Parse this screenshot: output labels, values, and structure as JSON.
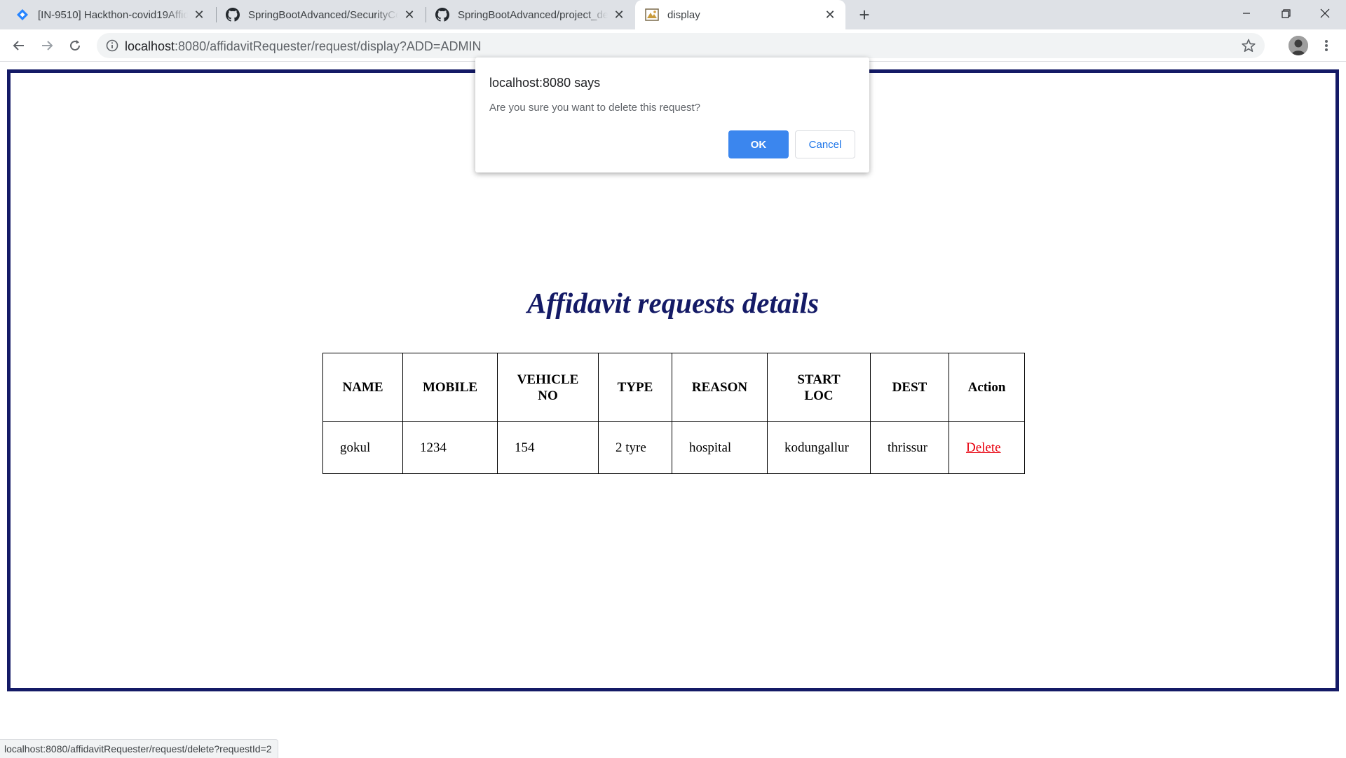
{
  "browser": {
    "tabs": [
      {
        "title": "[IN-9510] Hackthon-covid19Affidavit",
        "icon": "jira-diamond-icon",
        "active": false
      },
      {
        "title": "SpringBootAdvanced/SecurityConfig",
        "icon": "github-icon",
        "active": false
      },
      {
        "title": "SpringBootAdvanced/project_details",
        "icon": "github-icon",
        "active": false
      },
      {
        "title": "display",
        "icon": "page-favicon-icon",
        "active": true
      }
    ],
    "url_host": "localhost",
    "url_rest": ":8080/affidavitRequester/request/display?ADD=ADMIN",
    "status_url": "localhost:8080/affidavitRequester/request/delete?requestId=2"
  },
  "page": {
    "heading": "Affidavit requests details",
    "frame_color": "#141a66",
    "table": {
      "headers": [
        "NAME",
        "MOBILE",
        "VEHICLE NO",
        "TYPE",
        "REASON",
        "START LOC",
        "DEST",
        "Action"
      ],
      "rows": [
        [
          "gokul",
          "1234",
          "154",
          "2 tyre",
          "hospital",
          "kodungallur",
          "thrissur",
          "Delete"
        ]
      ],
      "link_color": "#e8000e"
    }
  },
  "dialog": {
    "title": "localhost:8080 says",
    "message": "Are you sure you want to delete this request?",
    "ok_label": "OK",
    "cancel_label": "Cancel"
  }
}
